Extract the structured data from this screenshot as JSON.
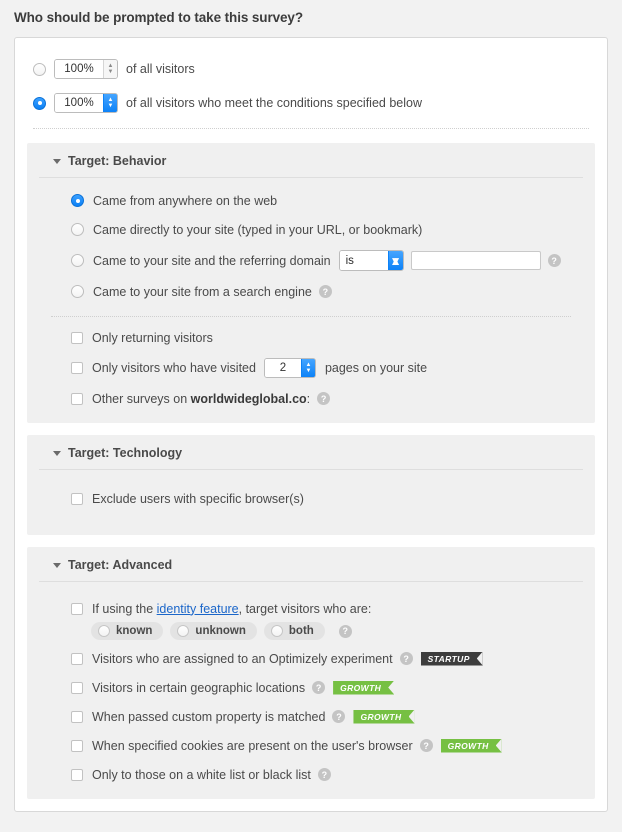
{
  "page": {
    "title": "Who should be prompted to take this survey?"
  },
  "sampling": {
    "option_a": {
      "value": "100%",
      "label": "of all visitors",
      "selected": false
    },
    "option_b": {
      "value": "100%",
      "label": "of all visitors who meet the conditions specified below",
      "selected": true
    }
  },
  "sections": [
    {
      "id": "behavior",
      "title": "Target: Behavior",
      "expanded": true
    },
    {
      "id": "technology",
      "title": "Target: Technology",
      "expanded": true
    },
    {
      "id": "advanced",
      "title": "Target: Advanced",
      "expanded": true
    }
  ],
  "behavior": {
    "radios": [
      {
        "label": "Came from anywhere on the web",
        "selected": true
      },
      {
        "label": "Came directly to your site (typed in your URL, or bookmark)",
        "selected": false
      },
      {
        "label": "Came to your site and the referring domain",
        "selected": false
      },
      {
        "label": "Came to your site from a search engine",
        "selected": false
      }
    ],
    "referring_domain": {
      "operator": "is",
      "operator_options": [
        "is"
      ],
      "value": "",
      "placeholder": ""
    },
    "checkboxes": [
      {
        "label": "Only returning visitors",
        "checked": false
      },
      {
        "label_before": "Only visitors who have visited",
        "pages": "2",
        "label_after": "pages on your site",
        "checked": false
      },
      {
        "label_before": "Other surveys on",
        "site": "worldwideglobal.co",
        "label_after": ":",
        "checked": false
      }
    ]
  },
  "technology": {
    "checkboxes": [
      {
        "label": "Exclude users with specific browser(s)",
        "checked": false
      }
    ]
  },
  "advanced": {
    "identity": {
      "checked": false,
      "text_before": "If using the",
      "link_text": "identity feature",
      "text_after": ", target visitors who are:",
      "pills": [
        {
          "label": "known",
          "selected": false
        },
        {
          "label": "unknown",
          "selected": false
        },
        {
          "label": "both",
          "selected": false
        }
      ]
    },
    "checkboxes": [
      {
        "label": "Visitors who are assigned to an Optimizely experiment",
        "checked": false,
        "badge": "STARTUP",
        "badge_type": "startup"
      },
      {
        "label": "Visitors in certain geographic locations",
        "checked": false,
        "badge": "GROWTH",
        "badge_type": "growth"
      },
      {
        "label": "When passed custom property is matched",
        "checked": false,
        "badge": "GROWTH",
        "badge_type": "growth"
      },
      {
        "label": "When specified cookies are present on the user's browser",
        "checked": false,
        "badge": "GROWTH",
        "badge_type": "growth"
      },
      {
        "label": "Only to those on a white list or black list",
        "checked": false,
        "badge": "",
        "badge_type": ""
      }
    ]
  },
  "icons": {
    "help": "?",
    "caret_down": "caret-down-icon",
    "spin_up": "▲",
    "spin_down": "▼"
  },
  "colors": {
    "accent_blue": "#1a8cff",
    "link_blue": "#1b66c9",
    "badge_startup": "#3d3d3d",
    "badge_growth": "#76c043",
    "panel_bg": "#f0f0f0",
    "page_bg": "#f2f2f2"
  }
}
